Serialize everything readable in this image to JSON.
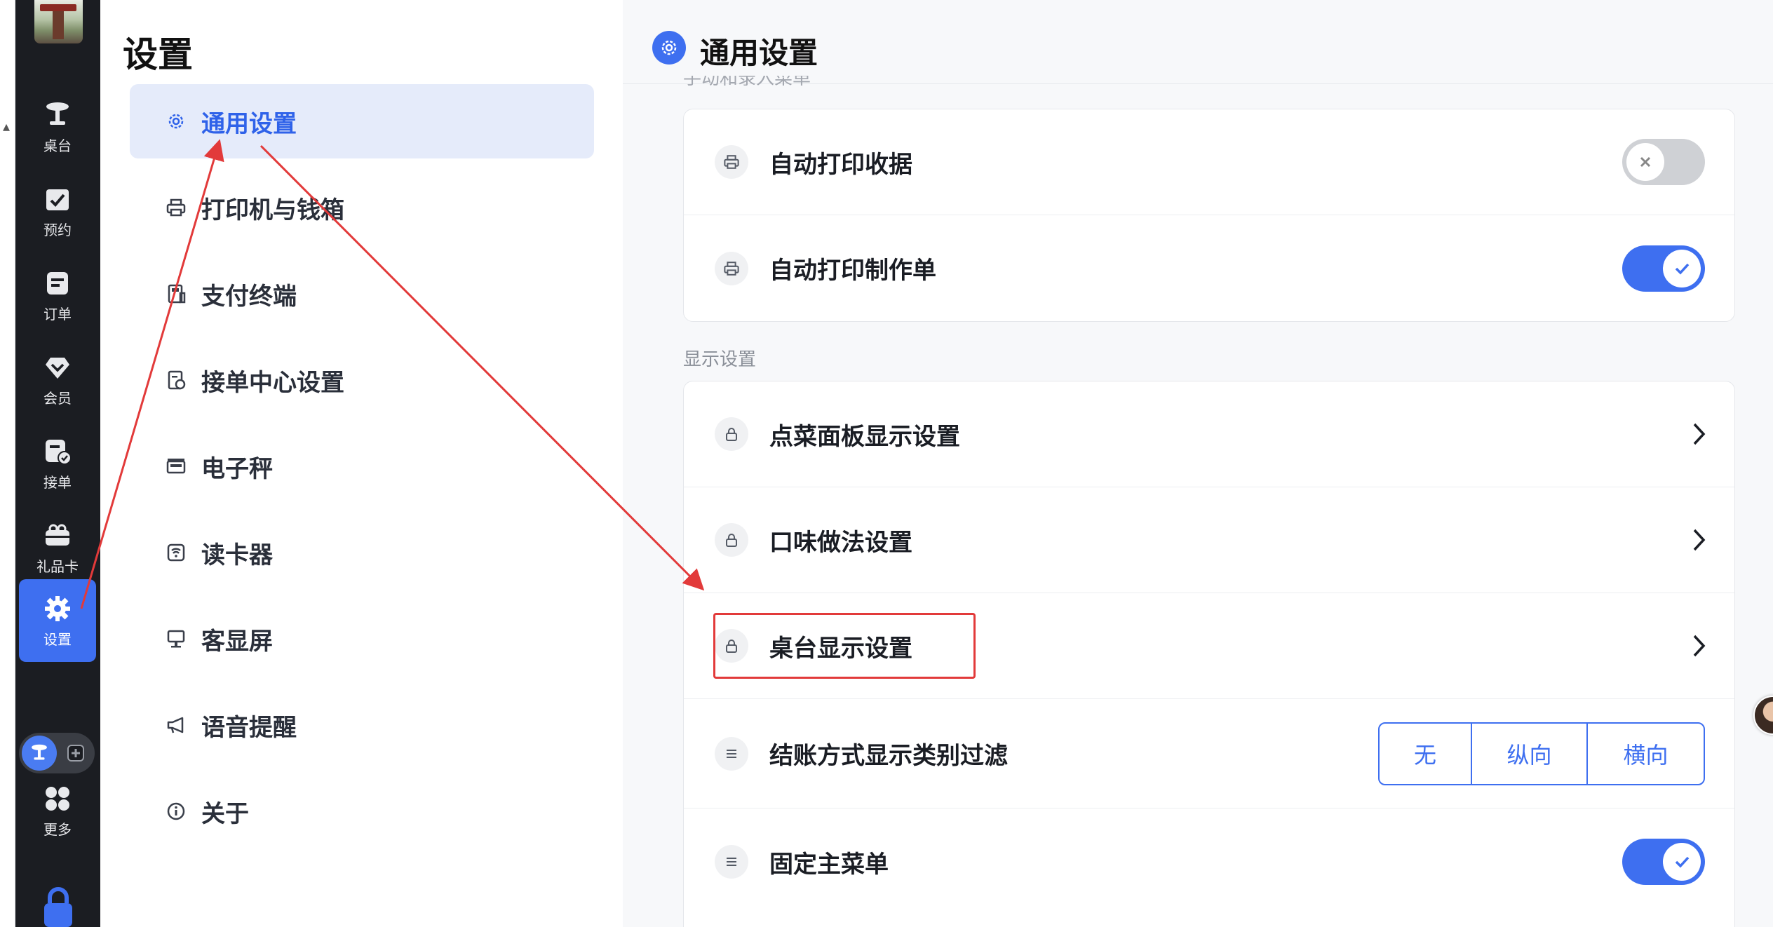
{
  "nav": {
    "items": [
      {
        "label": "桌台",
        "icon": "table-icon"
      },
      {
        "label": "预约",
        "icon": "reservation-icon"
      },
      {
        "label": "订单",
        "icon": "order-icon"
      },
      {
        "label": "会员",
        "icon": "member-icon"
      },
      {
        "label": "接单",
        "icon": "accept-order-icon"
      },
      {
        "label": "礼品卡",
        "icon": "gift-card-icon"
      },
      {
        "label": "设置",
        "icon": "settings-icon",
        "active": true
      }
    ],
    "more_label": "更多"
  },
  "settings_menu": {
    "title": "设置",
    "items": [
      {
        "label": "通用设置",
        "icon": "gear-icon",
        "active": true
      },
      {
        "label": "打印机与钱箱",
        "icon": "printer-icon"
      },
      {
        "label": "支付终端",
        "icon": "pos-terminal-icon"
      },
      {
        "label": "接单中心设置",
        "icon": "order-center-icon"
      },
      {
        "label": "电子秤",
        "icon": "scale-icon"
      },
      {
        "label": "读卡器",
        "icon": "card-reader-icon"
      },
      {
        "label": "客显屏",
        "icon": "customer-display-icon"
      },
      {
        "label": "语音提醒",
        "icon": "megaphone-icon"
      },
      {
        "label": "关于",
        "icon": "info-icon"
      }
    ]
  },
  "content": {
    "title": "通用设置",
    "cut_group_label": "手动和录入菜单",
    "print_rows": [
      {
        "label": "自动打印收据",
        "icon": "printer-icon",
        "toggle": "off"
      },
      {
        "label": "自动打印制作单",
        "icon": "printer-icon",
        "toggle": "on"
      }
    ],
    "display_group_label": "显示设置",
    "display_rows": [
      {
        "label": "点菜面板显示设置",
        "icon": "lock-icon"
      },
      {
        "label": "口味做法设置",
        "icon": "lock-icon"
      },
      {
        "label": "桌台显示设置",
        "icon": "lock-icon"
      },
      {
        "label": "结账方式显示类别过滤",
        "icon": "list-icon",
        "options": [
          "无",
          "纵向",
          "横向"
        ]
      },
      {
        "label": "固定主菜单",
        "icon": "list-icon",
        "toggle": "on"
      }
    ]
  },
  "colors": {
    "accent": "#3e6ff0",
    "rail_bg": "#1b1d22",
    "annotation_red": "#e23a3a"
  }
}
